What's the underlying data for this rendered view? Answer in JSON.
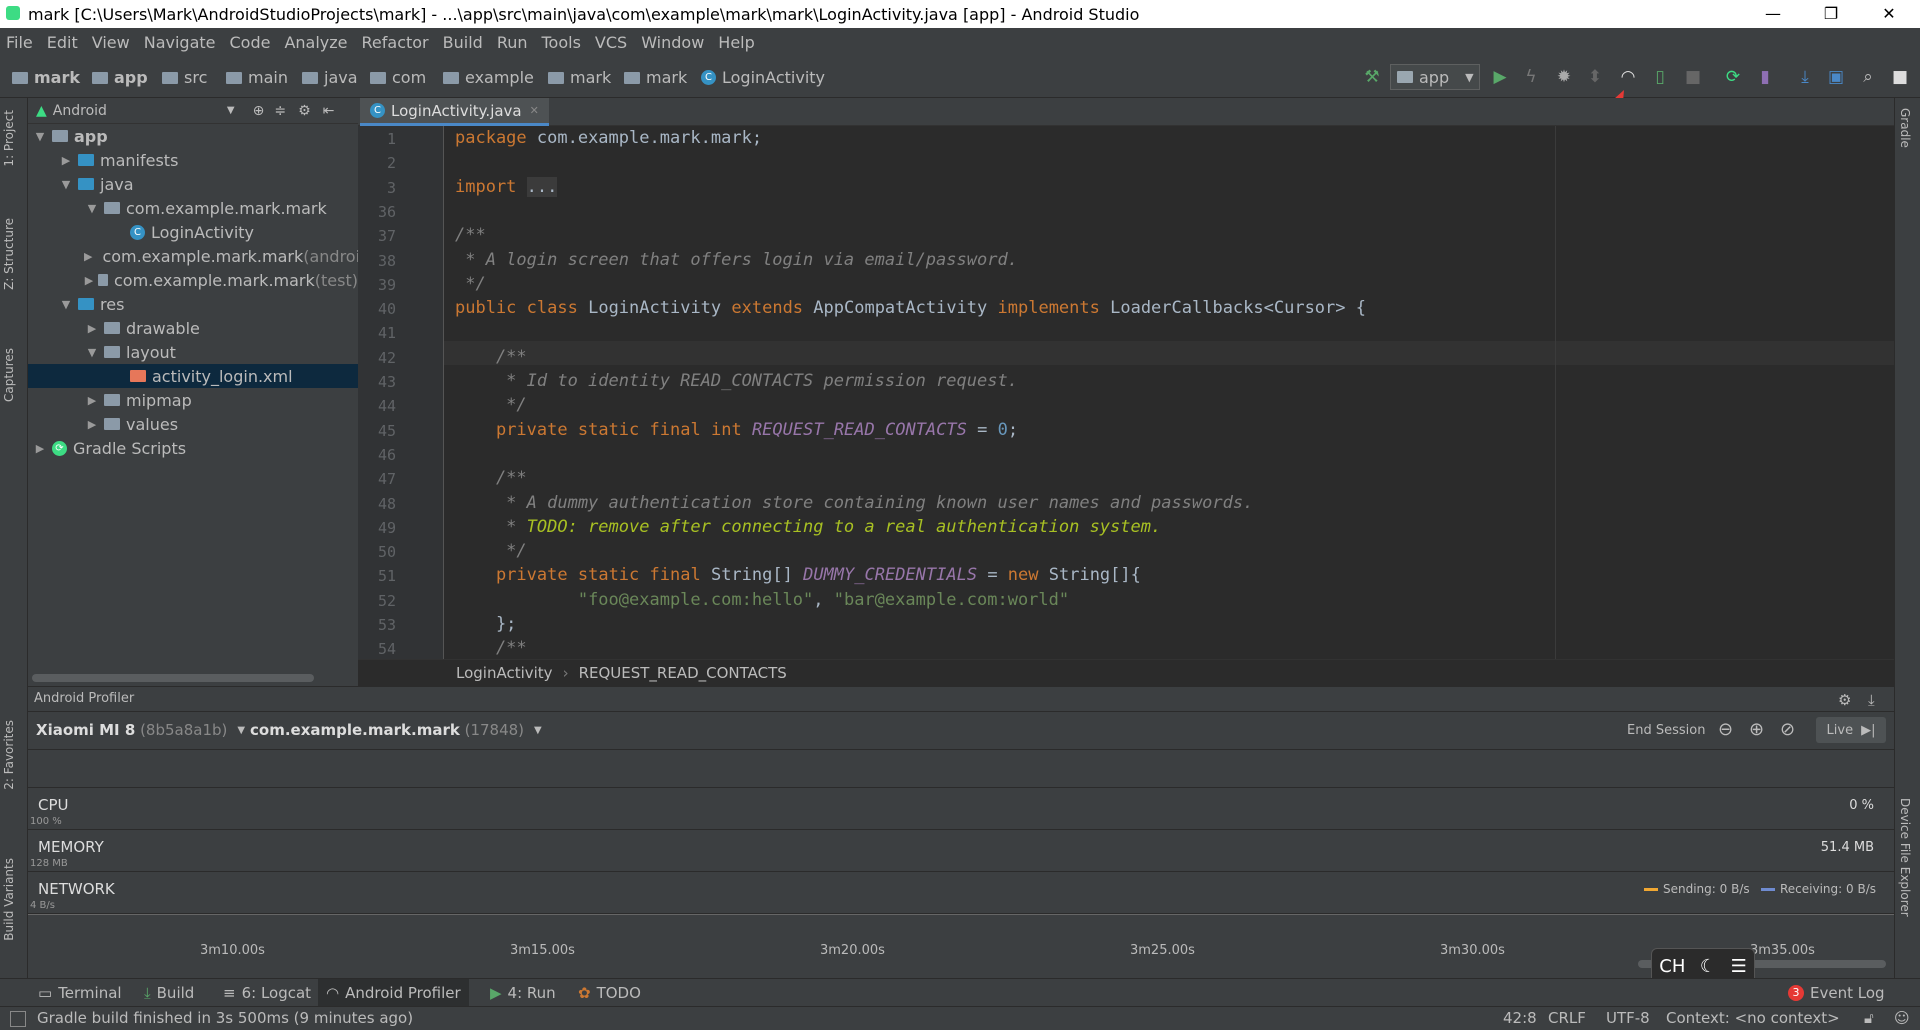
{
  "window": {
    "title": "mark [C:\\Users\\Mark\\AndroidStudioProjects\\mark] - ...\\app\\src\\main\\java\\com\\example\\mark\\mark\\LoginActivity.java [app] - Android Studio",
    "minimize": "—",
    "restore": "❐",
    "close": "✕"
  },
  "menu": [
    "File",
    "Edit",
    "View",
    "Navigate",
    "Code",
    "Analyze",
    "Refactor",
    "Build",
    "Run",
    "Tools",
    "VCS",
    "Window",
    "Help"
  ],
  "breadcrumb": [
    "mark",
    "app",
    "src",
    "main",
    "java",
    "com",
    "example",
    "mark",
    "mark",
    "LoginActivity"
  ],
  "toolbar": {
    "run_config": "app"
  },
  "project_panel": {
    "view_mode": "Android",
    "tabs": {
      "project": "1: Project",
      "structure": "Z: Structure",
      "captures": "Captures",
      "favorites": "2: Favorites",
      "build_variants": "Build Variants"
    },
    "tree": [
      {
        "label": "app",
        "arrow": "▼",
        "indent": 0,
        "suffix": ""
      },
      {
        "label": "manifests",
        "arrow": "▶",
        "indent": 1,
        "suffix": ""
      },
      {
        "label": "java",
        "arrow": "▼",
        "indent": 1,
        "suffix": ""
      },
      {
        "label": "com.example.mark.mark",
        "arrow": "▼",
        "indent": 2,
        "suffix": ""
      },
      {
        "label": "LoginActivity",
        "arrow": "",
        "indent": 3,
        "suffix": ""
      },
      {
        "label": "com.example.mark.mark",
        "arrow": "▶",
        "indent": 2,
        "suffix": " (androi"
      },
      {
        "label": "com.example.mark.mark",
        "arrow": "▶",
        "indent": 2,
        "suffix": " (test)"
      },
      {
        "label": "res",
        "arrow": "▼",
        "indent": 1,
        "suffix": ""
      },
      {
        "label": "drawable",
        "arrow": "▶",
        "indent": 2,
        "suffix": ""
      },
      {
        "label": "layout",
        "arrow": "▼",
        "indent": 2,
        "suffix": ""
      },
      {
        "label": "activity_login.xml",
        "arrow": "",
        "indent": 3,
        "suffix": ""
      },
      {
        "label": "mipmap",
        "arrow": "▶",
        "indent": 2,
        "suffix": ""
      },
      {
        "label": "values",
        "arrow": "▶",
        "indent": 2,
        "suffix": ""
      },
      {
        "label": "Gradle Scripts",
        "arrow": "▶",
        "indent": 0,
        "suffix": ""
      }
    ]
  },
  "editor": {
    "tab_label": "LoginActivity.java",
    "breadcrumb": [
      "LoginActivity",
      "REQUEST_READ_CONTACTS"
    ],
    "line_numbers": [
      "1",
      "2",
      "3",
      "36",
      "37",
      "38",
      "39",
      "40",
      "41",
      "42",
      "43",
      "44",
      "45",
      "46",
      "47",
      "48",
      "49",
      "50",
      "51",
      "52",
      "53",
      "54"
    ],
    "code": [
      "package com.example.mark.mark;",
      "",
      "import ...",
      "",
      "/**",
      " * A login screen that offers login via email/password.",
      " */",
      "public class LoginActivity extends AppCompatActivity implements LoaderCallbacks<Cursor> {",
      "",
      "    /**",
      "     * Id to identity READ_CONTACTS permission request.",
      "     */",
      "    private static final int REQUEST_READ_CONTACTS = 0;",
      "",
      "    /**",
      "     * A dummy authentication store containing known user names and passwords.",
      "     * TODO: remove after connecting to a real authentication system.",
      "     */",
      "    private static final String[] DUMMY_CREDENTIALS = new String[]{",
      "            \"foo@example.com:hello\", \"bar@example.com:world\"",
      "    };",
      "    /**"
    ]
  },
  "profiler": {
    "title": "Android Profiler",
    "device": "Xiaomi MI 8",
    "device_id": "(8b5a8a1b)",
    "process": "com.example.mark.mark",
    "pid": "(17848)",
    "end_session": "End Session",
    "live": "Live",
    "cpu": {
      "label": "CPU",
      "value": "0 %",
      "scale": "100 %"
    },
    "memory": {
      "label": "MEMORY",
      "value": "51.4 MB",
      "scale": "128 MB"
    },
    "network": {
      "label": "NETWORK",
      "scale": "4 B/s",
      "sending": "Sending: 0 B/s",
      "receiving": "Receiving: 0 B/s"
    },
    "ticks": [
      "3m10.00s",
      "3m15.00s",
      "3m20.00s",
      "3m25.00s",
      "3m30.00s",
      "3m35.00s"
    ]
  },
  "bottom_tabs": [
    "Terminal",
    "Build",
    "6: Logcat",
    "Android Profiler",
    "4: Run",
    "TODO"
  ],
  "event_log": {
    "count": "3",
    "label": "Event Log"
  },
  "status": {
    "message": "Gradle build finished in 3s 500ms (9 minutes ago)",
    "position": "42:8",
    "line_sep": "CRLF",
    "encoding": "UTF-8",
    "context": "Context: <no context>"
  },
  "right_strip": {
    "gradle": "Gradle",
    "device_explorer": "Device File Explorer"
  },
  "ime": {
    "lang": "CH"
  },
  "colors": {
    "accent": "#4a88c7",
    "run_green": "#59a869",
    "annotation_red": "#e53935"
  }
}
